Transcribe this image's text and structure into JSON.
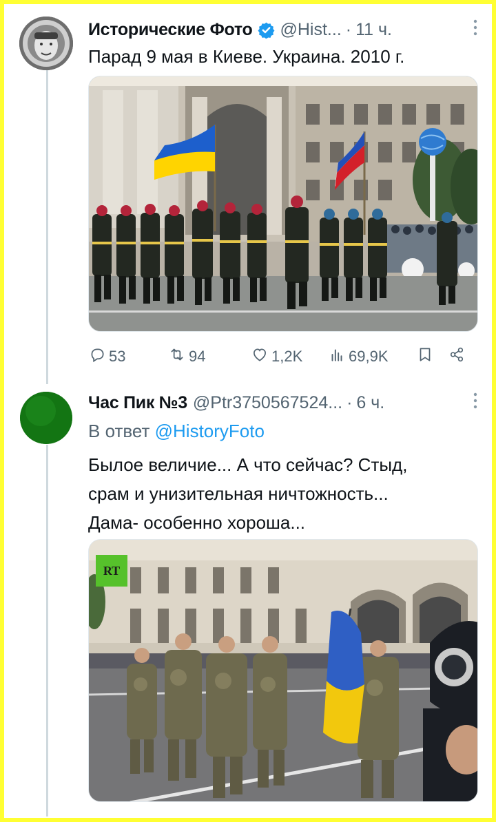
{
  "tweet1": {
    "name": "Исторические Фото",
    "handle": "@Hist...",
    "dot": "·",
    "time": "11 ч.",
    "text": "Парад 9 мая в Киеве. Украина. 2010 г.",
    "image_icon": "parade-photo",
    "actions": {
      "replies": "53",
      "retweets": "94",
      "likes": "1,2K",
      "views": "69,9K"
    }
  },
  "tweet2": {
    "name": "Час Пик №3",
    "handle": "@Ptr3750567524...",
    "dot": "·",
    "time": "6 ч.",
    "reply_prefix": "В ответ",
    "reply_mention": "@HistoryFoto",
    "text_lines": [
      "Былое величие... А что сейчас? Стыд,",
      "срам и унизительная ничтожность...",
      "Дама- особенно хороша..."
    ],
    "video_logo": "RT"
  },
  "icons": [
    "verified-icon",
    "more-icon",
    "reply-icon",
    "retweet-icon",
    "like-icon",
    "views-icon",
    "bookmark-icon",
    "share-icon"
  ],
  "colors": {
    "border": "#ffff33",
    "verified": "#1d9bf0",
    "link": "#1d9bf0",
    "muted": "#536471",
    "avatar2": "#1a7a1a"
  }
}
